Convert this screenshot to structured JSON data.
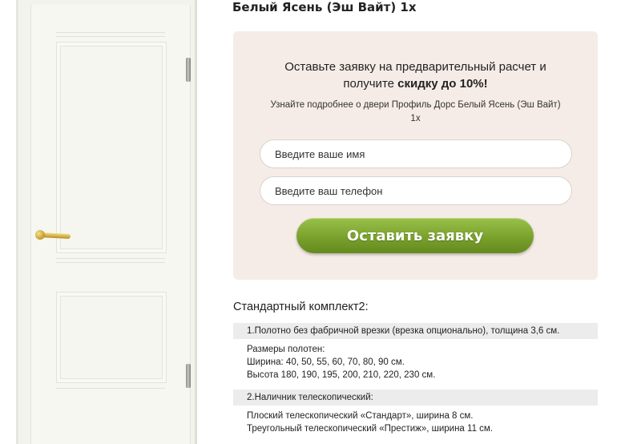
{
  "product": {
    "title": "Белый Ясень (Эш Вайт) 1х"
  },
  "promo": {
    "headline_line1": "Оставьте заявку на предварительный расчет и",
    "headline_line2_prefix": "получите ",
    "headline_line2_bold": "скидку до 10%!",
    "subtext_line1": "Узнайте подробнее о двери Профиль Дорс Белый Ясень (Эш Вайт)",
    "subtext_line2": "1х",
    "name_placeholder": "Введите ваше имя",
    "phone_placeholder": "Введите ваш телефон",
    "submit_label": "Оставить заявку",
    "box_color": "#f6ece7",
    "button_color": "#7aa12c"
  },
  "kit": {
    "title": "Стандартный комплект2:",
    "items": [
      {
        "heading": "1.Полотно без фабричной врезки (врезка опционально), толщина 3,6 см.",
        "lines": [
          "Размеры полотен:",
          "Ширина: 40, 50, 55, 60, 70, 80, 90 см.",
          "Высота 180, 190, 195, 200, 210, 220, 230 см."
        ]
      },
      {
        "heading": "2.Наличник телескопический:",
        "lines": [
          "Плоский телескопический «Стандарт», ширина 8 см.",
          "Треугольный телескопический «Престиж», ширина 11 см."
        ]
      }
    ]
  },
  "image": {
    "icon": "door-image",
    "handle_color": "#c9a233",
    "door_color": "#f6f7f1"
  }
}
